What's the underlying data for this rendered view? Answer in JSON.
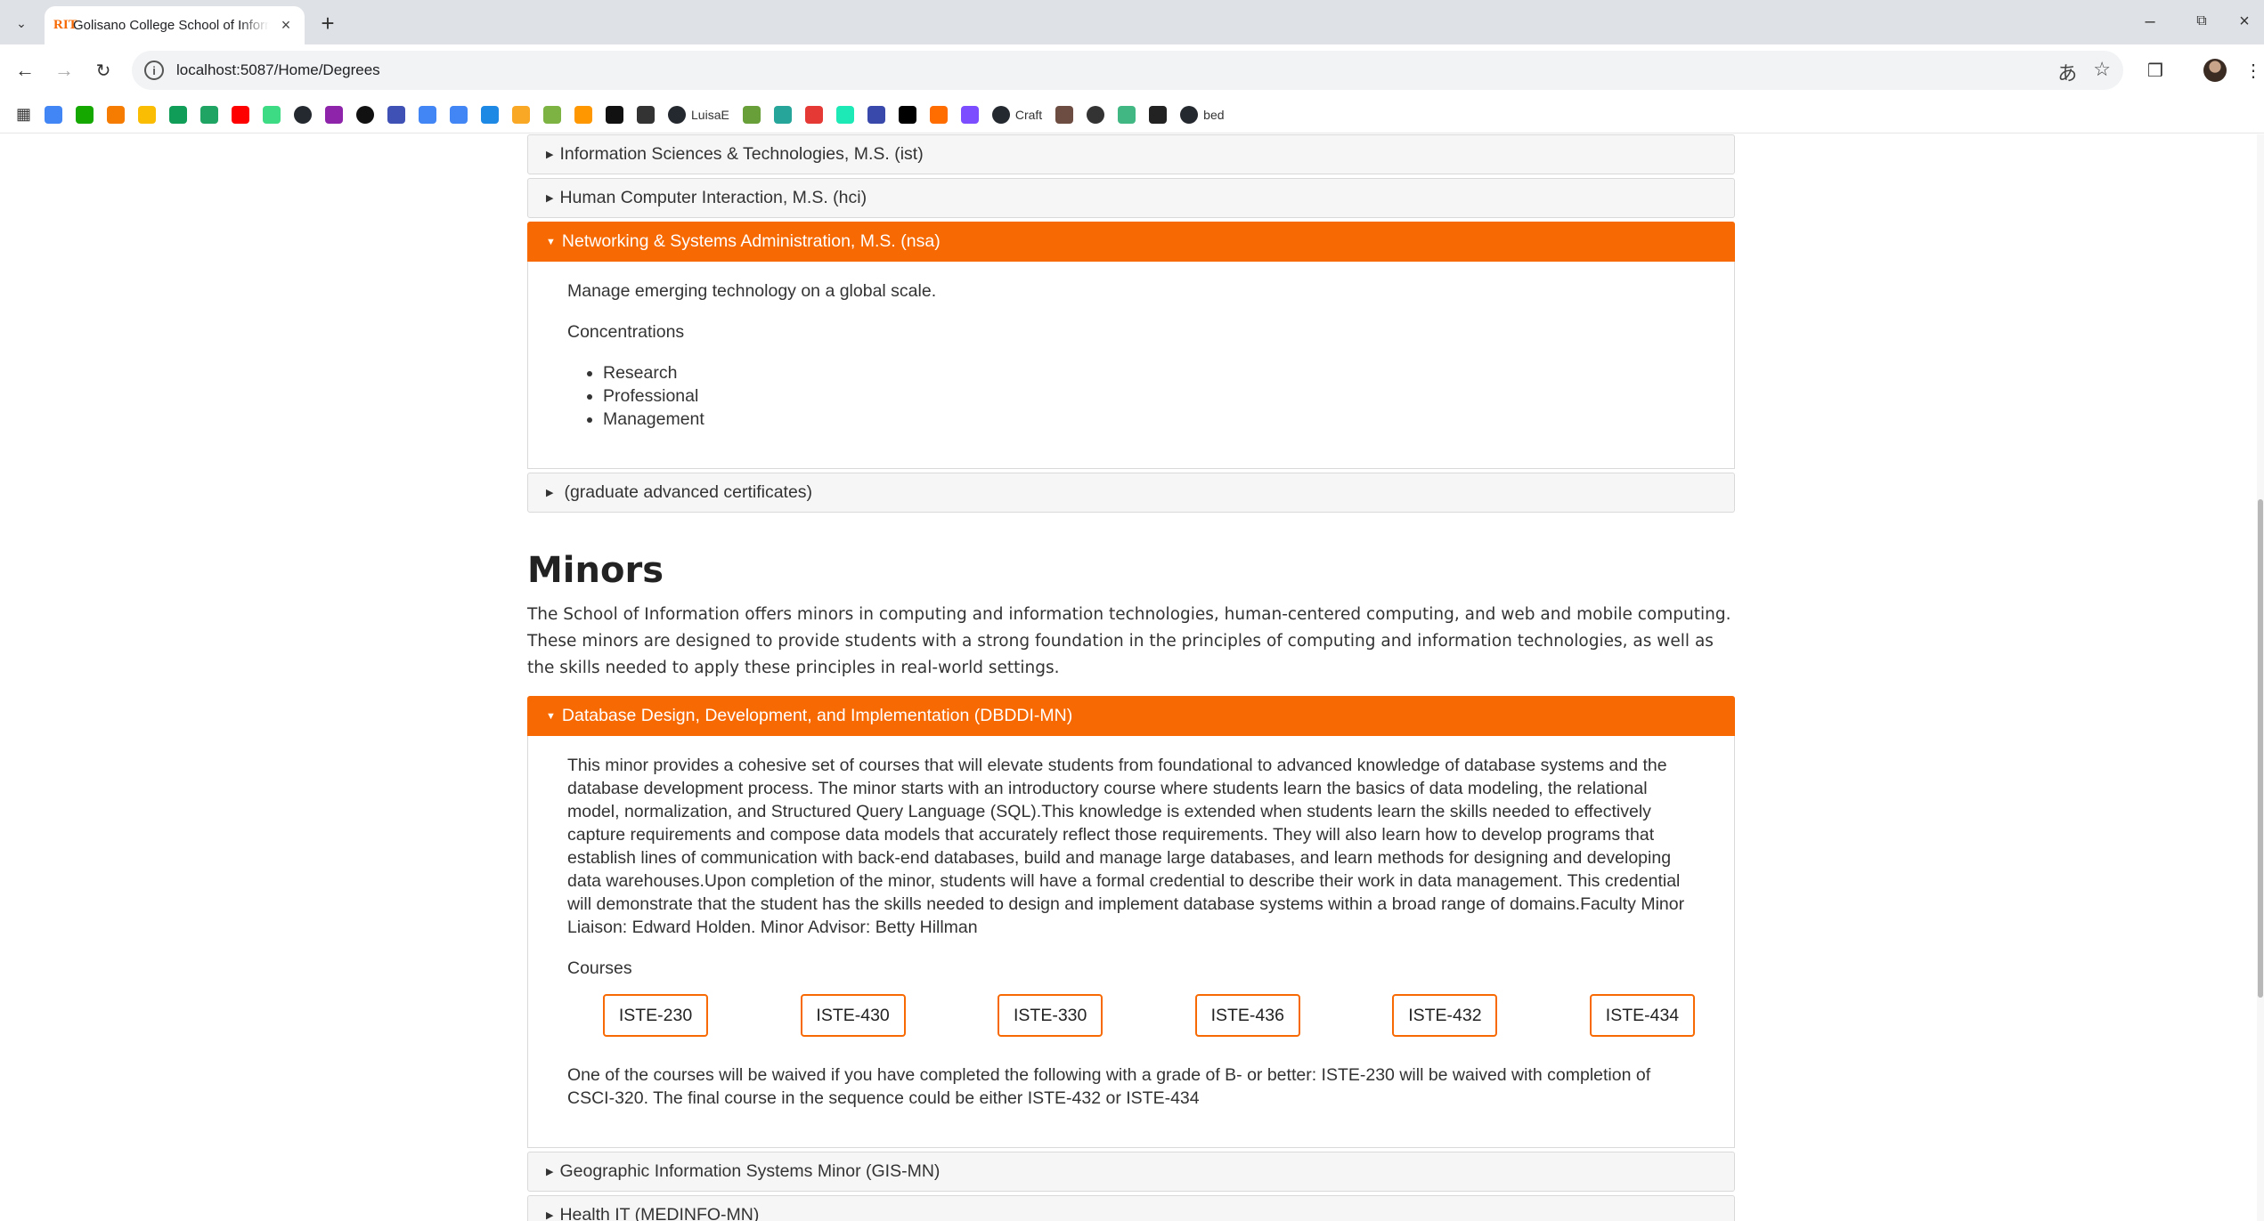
{
  "browser": {
    "tab_title": "Golisano College School of Information",
    "tab_favicon": "RIT",
    "url": "localhost:5087/Home/Degrees",
    "bookmarks": [
      {
        "icon": "docs-icon",
        "color": "#4285f4",
        "label": ""
      },
      {
        "icon": "upwork-icon",
        "color": "#14a800",
        "label": ""
      },
      {
        "icon": "gear-orange-icon",
        "color": "#f57c00",
        "label": ""
      },
      {
        "icon": "slides-icon",
        "color": "#fbbc04",
        "label": ""
      },
      {
        "icon": "sheets-icon",
        "color": "#0f9d58",
        "label": ""
      },
      {
        "icon": "drive-icon",
        "color": "#1fa463",
        "label": ""
      },
      {
        "icon": "youtube-icon",
        "color": "#ff0000",
        "label": ""
      },
      {
        "icon": "android-icon",
        "color": "#3ddc84",
        "label": ""
      },
      {
        "icon": "github-icon",
        "color": "#24292f",
        "label": ""
      },
      {
        "icon": "app-purple-icon",
        "color": "#8e24aa",
        "label": ""
      },
      {
        "icon": "openai-icon",
        "color": "#111111",
        "label": ""
      },
      {
        "icon": "app-blue-icon",
        "color": "#3f51b5",
        "label": ""
      },
      {
        "icon": "gemini-icon",
        "color": "#4285f4",
        "label": ""
      },
      {
        "icon": "translate-icon",
        "color": "#4285f4",
        "label": ""
      },
      {
        "icon": "calendar-icon",
        "color": "#1e88e5",
        "label": ""
      },
      {
        "icon": "app-yellow-icon",
        "color": "#f9a825",
        "label": ""
      },
      {
        "icon": "app-lime-icon",
        "color": "#7cb342",
        "label": ""
      },
      {
        "icon": "app-orange-icon",
        "color": "#ff9800",
        "label": ""
      },
      {
        "icon": "notion-icon",
        "color": "#111111",
        "label": ""
      },
      {
        "icon": "stack-icon",
        "color": "#333333",
        "label": ""
      },
      {
        "icon": "github-icon",
        "color": "#24292f",
        "label": "LuisaE"
      },
      {
        "icon": "image-icon",
        "color": "#689f38",
        "label": ""
      },
      {
        "icon": "app-teal-icon",
        "color": "#26a69a",
        "label": ""
      },
      {
        "icon": "app-red-icon",
        "color": "#e53935",
        "label": ""
      },
      {
        "icon": "app-green-icon",
        "color": "#1de9b6",
        "label": ""
      },
      {
        "icon": "tools-icon",
        "color": "#3949ab",
        "label": ""
      },
      {
        "icon": "app-dark-icon",
        "color": "#000000",
        "label": ""
      },
      {
        "icon": "api-icon",
        "color": "#ff6d00",
        "label": ""
      },
      {
        "icon": "shield-icon",
        "color": "#7c4dff",
        "label": ""
      },
      {
        "icon": "github-icon",
        "color": "#24292f",
        "label": "Craft"
      },
      {
        "icon": "app-brown-icon",
        "color": "#6d4c41",
        "label": ""
      },
      {
        "icon": "globe-icon",
        "color": "#333333",
        "label": ""
      },
      {
        "icon": "vue-icon",
        "color": "#41b883",
        "label": ""
      },
      {
        "icon": "cube-icon",
        "color": "#222222",
        "label": ""
      },
      {
        "icon": "github-icon",
        "color": "#24292f",
        "label": "bed"
      }
    ]
  },
  "accordion_top": [
    {
      "label": "Information Sciences & Technologies, M.S. (ist)",
      "expanded": false
    },
    {
      "label": "Human Computer Interaction, M.S. (hci)",
      "expanded": false
    },
    {
      "label": "Networking & Systems Administration, M.S. (nsa)",
      "expanded": true
    }
  ],
  "nsa": {
    "description": "Manage emerging technology on a global scale.",
    "concentrations_label": "Concentrations",
    "concentrations": [
      "Research",
      "Professional",
      "Management"
    ]
  },
  "certificates_label": "(graduate advanced certificates)",
  "minors": {
    "title": "Minors",
    "intro": "The School of Information offers minors in computing and information technologies, human-centered computing, and web and mobile computing. These minors are designed to provide students with a strong foundation in the principles of computing and information technologies, as well as the skills needed to apply these principles in real-world settings.",
    "dbddi": {
      "label": "Database Design, Development, and Implementation (DBDDI-MN)",
      "description": "This minor provides a cohesive set of courses that will elevate students from foundational to advanced knowledge of database systems and the database development process. The minor starts with an introductory course where students learn the basics of data modeling, the relational model, normalization, and Structured Query Language (SQL).This knowledge is extended when students learn the skills needed to effectively capture requirements and compose data models that accurately reflect those requirements. They will also learn how to develop programs that establish lines of communication with back-end databases, build and manage large databases, and learn methods for designing and developing data warehouses.Upon completion of the minor, students will have a formal credential to describe their work in data management. This credential will demonstrate that the student has the skills needed to design and implement database systems within a broad range of domains.Faculty Minor Liaison: Edward Holden. Minor Advisor: Betty Hillman",
      "courses_label": "Courses",
      "courses": [
        "ISTE-230",
        "ISTE-430",
        "ISTE-330",
        "ISTE-436",
        "ISTE-432",
        "ISTE-434"
      ],
      "note": "One of the courses will be waived if you have completed the following with a grade of B- or better: ISTE-230 will be waived with completion of CSCI-320. The final course in the sequence could be either ISTE-432 or ISTE-434"
    },
    "gis_label": "Geographic Information Systems Minor (GIS-MN)",
    "health_label": "Health IT (MEDINFO-MN)"
  },
  "colors": {
    "accent": "#f76902",
    "header_bg": "#f6f6f6"
  }
}
